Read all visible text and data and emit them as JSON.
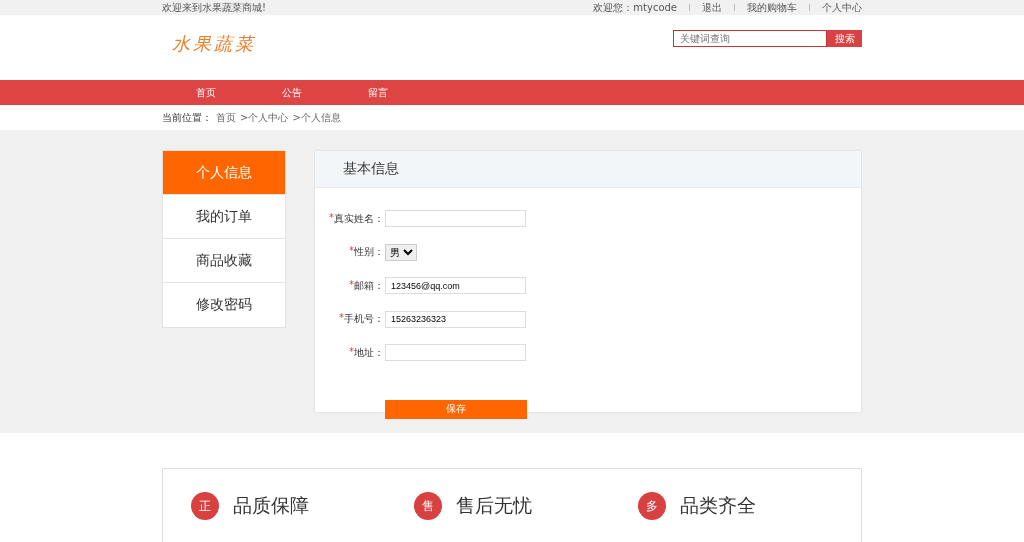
{
  "topbar": {
    "welcome": "欢迎来到水果蔬菜商城!",
    "user_greeting": "欢迎您：mtycode",
    "links": [
      "退出",
      "我的购物车",
      "个人中心"
    ]
  },
  "header": {
    "logo": "水果蔬菜",
    "search": {
      "placeholder": "关键词查询",
      "button": "搜索"
    }
  },
  "nav": [
    {
      "label": "首页"
    },
    {
      "label": "公告"
    },
    {
      "label": "留言"
    }
  ],
  "breadcrumb": {
    "label": "当前位置：",
    "items": [
      "首页",
      ">个人中心",
      ">个人信息"
    ]
  },
  "sidebar": {
    "items": [
      {
        "label": "个人信息",
        "selected": true
      },
      {
        "label": "我的订单",
        "selected": false
      },
      {
        "label": "商品收藏",
        "selected": false
      },
      {
        "label": "修改密码",
        "selected": false
      }
    ]
  },
  "panel": {
    "title": "基本信息",
    "fields": [
      {
        "kind": "text",
        "mark": "*",
        "label": "真实姓名："
      },
      {
        "kind": "select",
        "mark": "*",
        "label": "性别：",
        "value": "男"
      },
      {
        "kind": "text",
        "mark": "*",
        "label": "邮箱：",
        "value": "123456@qq.com"
      },
      {
        "kind": "text",
        "mark": "*",
        "label": "手机号：",
        "value": "15263236323"
      },
      {
        "kind": "text",
        "mark": "*",
        "label": "地址："
      }
    ],
    "save_button": "保存"
  },
  "features": [
    {
      "icon_char": "正",
      "label": "品质保障"
    },
    {
      "icon_char": "售",
      "label": "售后无忧"
    },
    {
      "icon_char": "多",
      "label": "品类齐全"
    }
  ]
}
